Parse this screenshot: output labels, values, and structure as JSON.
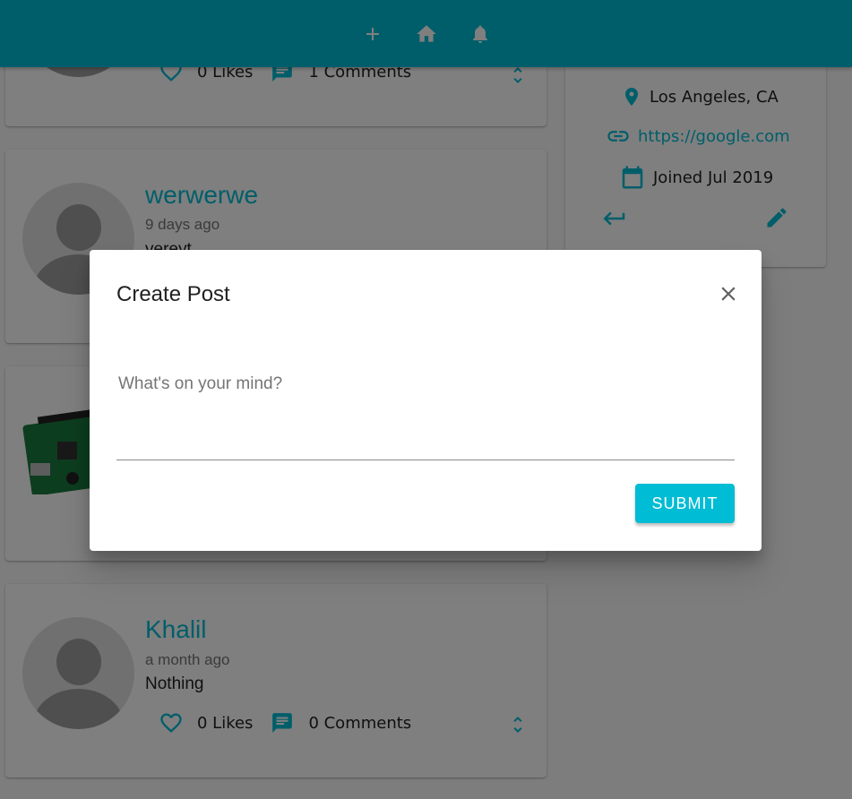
{
  "nav": {
    "icons": [
      "add-icon",
      "home-icon",
      "bell-icon"
    ]
  },
  "posts": [
    {
      "likes": "0 Likes",
      "comments": "1 Comments"
    },
    {
      "user": "werwerwe",
      "time": "9 days ago",
      "body": "vereyt"
    },
    {
      "image": "raspberry-pi-board"
    },
    {
      "user": "Khalil",
      "time": "a month ago",
      "body": "Nothing",
      "likes": "0 Likes",
      "comments": "0 Comments"
    }
  ],
  "profile": {
    "location": "Los Angeles, CA",
    "website": "https://google.com",
    "joined": "Joined Jul 2019"
  },
  "dialog": {
    "title": "Create Post",
    "placeholder": "What's on your mind?",
    "value": "",
    "submit_label": "SUBMIT"
  },
  "colors": {
    "primary": "#00bcd4",
    "overlay": "rgba(0,0,0,0.5)"
  }
}
